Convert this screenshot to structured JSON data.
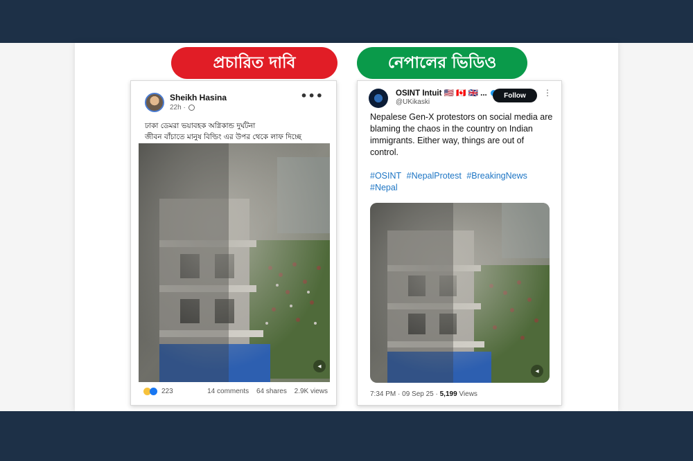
{
  "labels": {
    "claim": "প্রচারিত দাবি",
    "fact": "নেপালের ভিডিও"
  },
  "facebook_post": {
    "author": "Sheikh Hasina",
    "time": "22h ·",
    "caption_line1": "ঢাকা ডেমরা ভয়াবহক অগ্নিকান্ড দুর্ঘটনা",
    "caption_line2": "জীবন বাঁচাতে মানুষ বিল্ডিং এর উপর থেকে লাফ দিচ্ছে",
    "reactions_count": "223",
    "comments": "14 comments",
    "shares": "64 shares",
    "views": "2.9K views",
    "more_glyph": "•••",
    "icons": [
      "globe-icon",
      "sad-reaction-icon",
      "like-reaction-icon",
      "mute-icon"
    ]
  },
  "twitter_post": {
    "author": "OSINT Intuit 🇺🇸 🇨🇦 🇬🇧 ...",
    "handle": "@UKikaski",
    "follow_label": "Follow",
    "more_glyph": "⋮",
    "text": "Nepalese Gen-X protestors on social media are blaming the chaos in the country on Indian immigrants. Either way, things are out of control.",
    "hashtags": [
      "#OSINT",
      "#NepalProtest",
      "#BreakingNews",
      "#Nepal"
    ],
    "timestamp": "7:34 PM · 09 Sep 25 · ",
    "views_count": "5,199",
    "views_label": " Views",
    "icons": [
      "verified-icon",
      "mute-icon"
    ]
  },
  "colors": {
    "frame": "#1d3047",
    "claim_pill": "#e11d26",
    "fact_pill": "#0a9a4a",
    "hashtag": "#1d75c4"
  }
}
